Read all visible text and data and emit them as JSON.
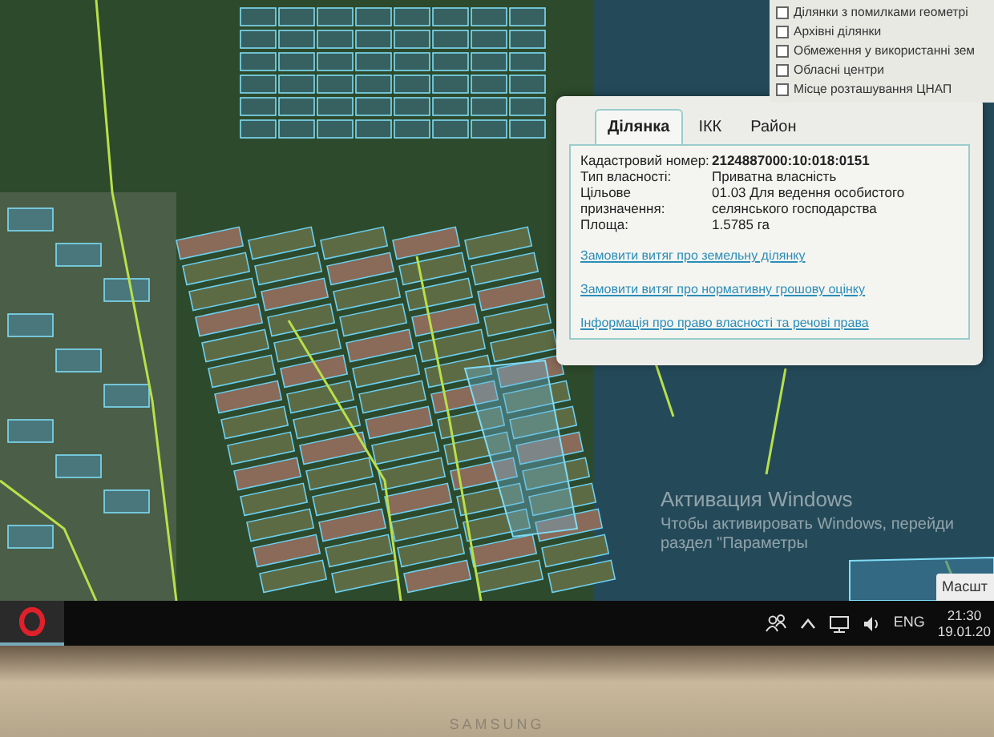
{
  "map": {
    "layers_panel": {
      "items": [
        {
          "label": "Ділянки з помилками геометрі",
          "checked": false
        },
        {
          "label": "Архівні ділянки",
          "checked": false
        },
        {
          "label": "Обмеження у використанні зем",
          "checked": false
        },
        {
          "label": "Обласні центри",
          "checked": false
        },
        {
          "label": "Місце розташування ЦНАП",
          "checked": false
        }
      ]
    },
    "popup": {
      "tabs": [
        {
          "label": "Ділянка",
          "selected": true
        },
        {
          "label": "ІКК",
          "selected": false
        },
        {
          "label": "Район",
          "selected": false
        }
      ],
      "fields": [
        {
          "label": "Кадастровий номер:",
          "value": "2124887000:10:018:0151",
          "bold": true
        },
        {
          "label": "Тип власності:",
          "value": "Приватна власність",
          "bold": false
        },
        {
          "label": "Цільове призначення:",
          "value": "01.03 Для ведення особистого селянського господарства",
          "bold": false
        },
        {
          "label": "Площа:",
          "value": "1.5785 га",
          "bold": false
        }
      ],
      "links": [
        "Замовити витяг про земельну ділянку",
        "Замовити витяг про нормативну грошову оцінку",
        "Інформація про право власності та речові права"
      ]
    },
    "activation": {
      "title": "Активация Windows",
      "lines": [
        "Чтобы активировать Windows, перейди",
        "раздел \"Параметры"
      ]
    },
    "scale_button": "Масшт"
  },
  "taskbar": {
    "language": "ENG",
    "time": "21:30",
    "date": "19.01.20"
  },
  "bezel": {
    "brand": "SAMSUNG"
  }
}
